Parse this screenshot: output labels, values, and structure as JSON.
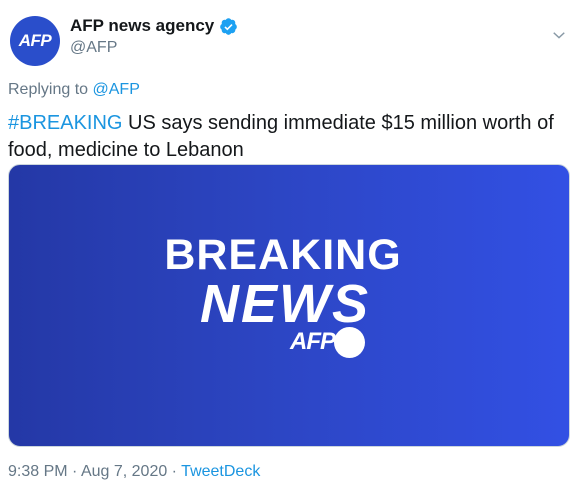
{
  "account": {
    "avatar_text": "AFP",
    "display_name": "AFP news agency",
    "handle": "@AFP",
    "verified_icon": "verified-badge-icon",
    "verified_color": "#1da1f2"
  },
  "reply": {
    "prefix": "Replying to",
    "target": "@AFP"
  },
  "tweet": {
    "hashtag": "#BREAKING",
    "text": " US says sending immediate $15 million worth of food, medicine to Lebanon"
  },
  "media": {
    "line1": "BREAKING",
    "line2": "NEWS",
    "logo": "AFP",
    "gradient_left": "#2438a6",
    "gradient_right": "#3250e4"
  },
  "meta": {
    "time": "9:38 PM",
    "separator1": " · ",
    "date": "Aug 7, 2020",
    "separator2": " · ",
    "source": "TweetDeck"
  },
  "colors": {
    "link": "#1b95e0",
    "muted": "#657786",
    "text": "#14171a",
    "avatar_bg": "#2a4ecb"
  },
  "icons": {
    "menu": "chevron-down-icon"
  }
}
